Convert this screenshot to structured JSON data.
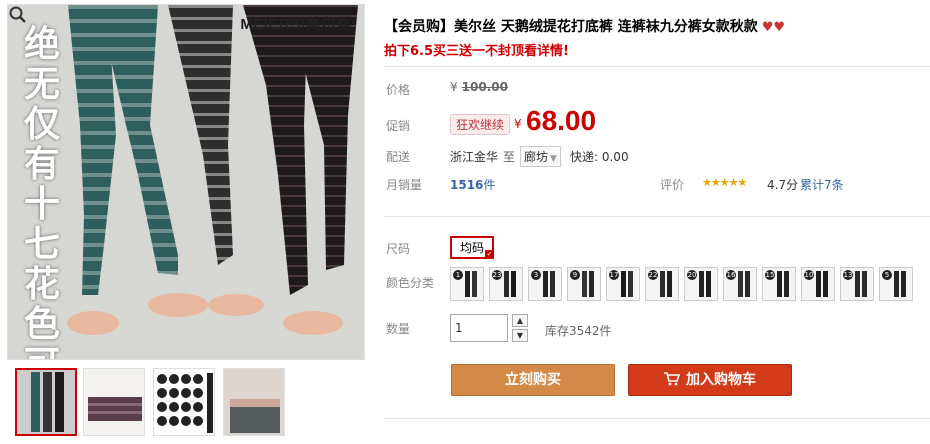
{
  "product": {
    "brand": "MEIERSI美尔丝",
    "image_text": "绝无仅有十七花色可选",
    "title": "【会员购】美尔丝 天鹅绒提花打底裤 连裤袜九分裤女款秋款",
    "subtitle": "拍下6.5买三送一不封顶看详情!",
    "heart_icon": "heart-icon"
  },
  "price": {
    "label": "价格",
    "currency": "¥",
    "original": "100.00",
    "promo_label": "促销",
    "promo_badge": "狂欢继续",
    "current": "68.00"
  },
  "shipping": {
    "label": "配送",
    "from": "浙江金华",
    "to_label": "至",
    "to": "廊坊",
    "fee": "快递: 0.00"
  },
  "sales": {
    "label": "月销量",
    "count": "1516",
    "unit": "件",
    "rating_label": "评价",
    "stars": "★★★★★",
    "rating": 4.7,
    "score_text": "4.7分",
    "reviews": "累计7条"
  },
  "options": {
    "size_label": "尺码",
    "size_value": "均码",
    "color_label": "颜色分类",
    "color_swatches": [
      "1",
      "23",
      "3",
      "9",
      "17",
      "22",
      "20",
      "16",
      "15",
      "10",
      "13",
      "5"
    ]
  },
  "quantity": {
    "label": "数量",
    "value": "1",
    "stock": "库存3542件"
  },
  "actions": {
    "buy_now": "立刻购买",
    "add_to_cart": "加入购物车"
  },
  "colors": {
    "accent_red": "#c00",
    "buy_button": "#d38a48",
    "cart_button": "#d33a1a",
    "link_blue": "#3366aa"
  }
}
